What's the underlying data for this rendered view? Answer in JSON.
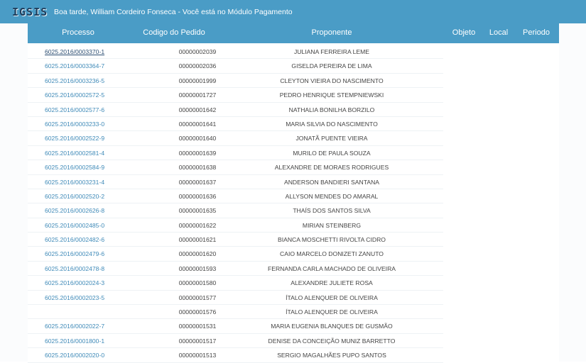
{
  "header": {
    "logo": "IGSIS",
    "greeting": "Boa tarde, William Cordeiro Fonseca - Você está no Módulo Pagamento"
  },
  "columns": {
    "processo": "Processo",
    "pedido": "Codigo do Pedido",
    "proponente": "Proponente",
    "objeto": "Objeto",
    "local": "Local",
    "periodo": "Periodo"
  },
  "rows": [
    {
      "processo": "6025.2016/0003370-1",
      "pedido": "00000002039",
      "proponente": "JULIANA FERREIRA LEME"
    },
    {
      "processo": "6025.2016/0003364-7",
      "pedido": "00000002036",
      "proponente": "GISELDA PEREIRA DE LIMA"
    },
    {
      "processo": "6025.2016/0003236-5",
      "pedido": "00000001999",
      "proponente": "CLEYTON VIEIRA DO NASCIMENTO"
    },
    {
      "processo": "6025.2016/0002572-5",
      "pedido": "00000001727",
      "proponente": "PEDRO HENRIQUE STEMPNIEWSKI"
    },
    {
      "processo": "6025.2016/0002577-6",
      "pedido": "00000001642",
      "proponente": "NATHALIA BONILHA BORZILO"
    },
    {
      "processo": "6025.2016/0003233-0",
      "pedido": "00000001641",
      "proponente": "MARIA SILVIA DO NASCIMENTO"
    },
    {
      "processo": "6025.2016/0002522-9",
      "pedido": "00000001640",
      "proponente": "JONATÃ PUENTE VIEIRA"
    },
    {
      "processo": "6025.2016/0002581-4",
      "pedido": "00000001639",
      "proponente": "MURILO DE PAULA SOUZA"
    },
    {
      "processo": "6025.2016/0002584-9",
      "pedido": "00000001638",
      "proponente": "ALEXANDRE DE MORAES RODRIGUES"
    },
    {
      "processo": "6025.2016/0003231-4",
      "pedido": "00000001637",
      "proponente": "ANDERSON BANDIERI SANTANA"
    },
    {
      "processo": "6025.2016/0002520-2",
      "pedido": "00000001636",
      "proponente": "ALLYSON MENDES DO AMARAL"
    },
    {
      "processo": "6025.2016/0002626-8",
      "pedido": "00000001635",
      "proponente": "THAÍS DOS SANTOS SILVA"
    },
    {
      "processo": "6025.2016/0002485-0",
      "pedido": "00000001622",
      "proponente": "MIRIAN STEINBERG"
    },
    {
      "processo": "6025.2016/0002482-6",
      "pedido": "00000001621",
      "proponente": "BIANCA MOSCHETTI RIVOLTA CIDRO"
    },
    {
      "processo": "6025.2016/0002479-6",
      "pedido": "00000001620",
      "proponente": "CAIO MARCELO DONIZETI ZANUTO"
    },
    {
      "processo": "6025.2016/0002478-8",
      "pedido": "00000001593",
      "proponente": "FERNANDA CARLA MACHADO DE OLIVEIRA"
    },
    {
      "processo": "6025.2016/0002024-3",
      "pedido": "00000001580",
      "proponente": "ALEXANDRE JULIETE ROSA"
    },
    {
      "processo": "6025.2016/0002023-5",
      "pedido": "00000001577",
      "proponente": "ÍTALO ALENQUER DE OLIVEIRA"
    },
    {
      "processo": "",
      "pedido": "00000001576",
      "proponente": "ÍTALO ALENQUER DE OLIVEIRA"
    },
    {
      "processo": "6025.2016/0002022-7",
      "pedido": "00000001531",
      "proponente": "MARIA EUGENIA BLANQUES DE GUSMÃO"
    },
    {
      "processo": "6025.2016/0001800-1",
      "pedido": "00000001517",
      "proponente": "DENISE DA CONCEIÇÃO MUNIZ BARRETTO"
    },
    {
      "processo": "6025.2016/0002020-0",
      "pedido": "00000001513",
      "proponente": "SERGIO MAGALHÃES PUPO SANTOS"
    }
  ],
  "colors": {
    "header_bg": "#4a9cc6",
    "link": "#3f8ab8",
    "link_visited": "#2d4f73"
  }
}
